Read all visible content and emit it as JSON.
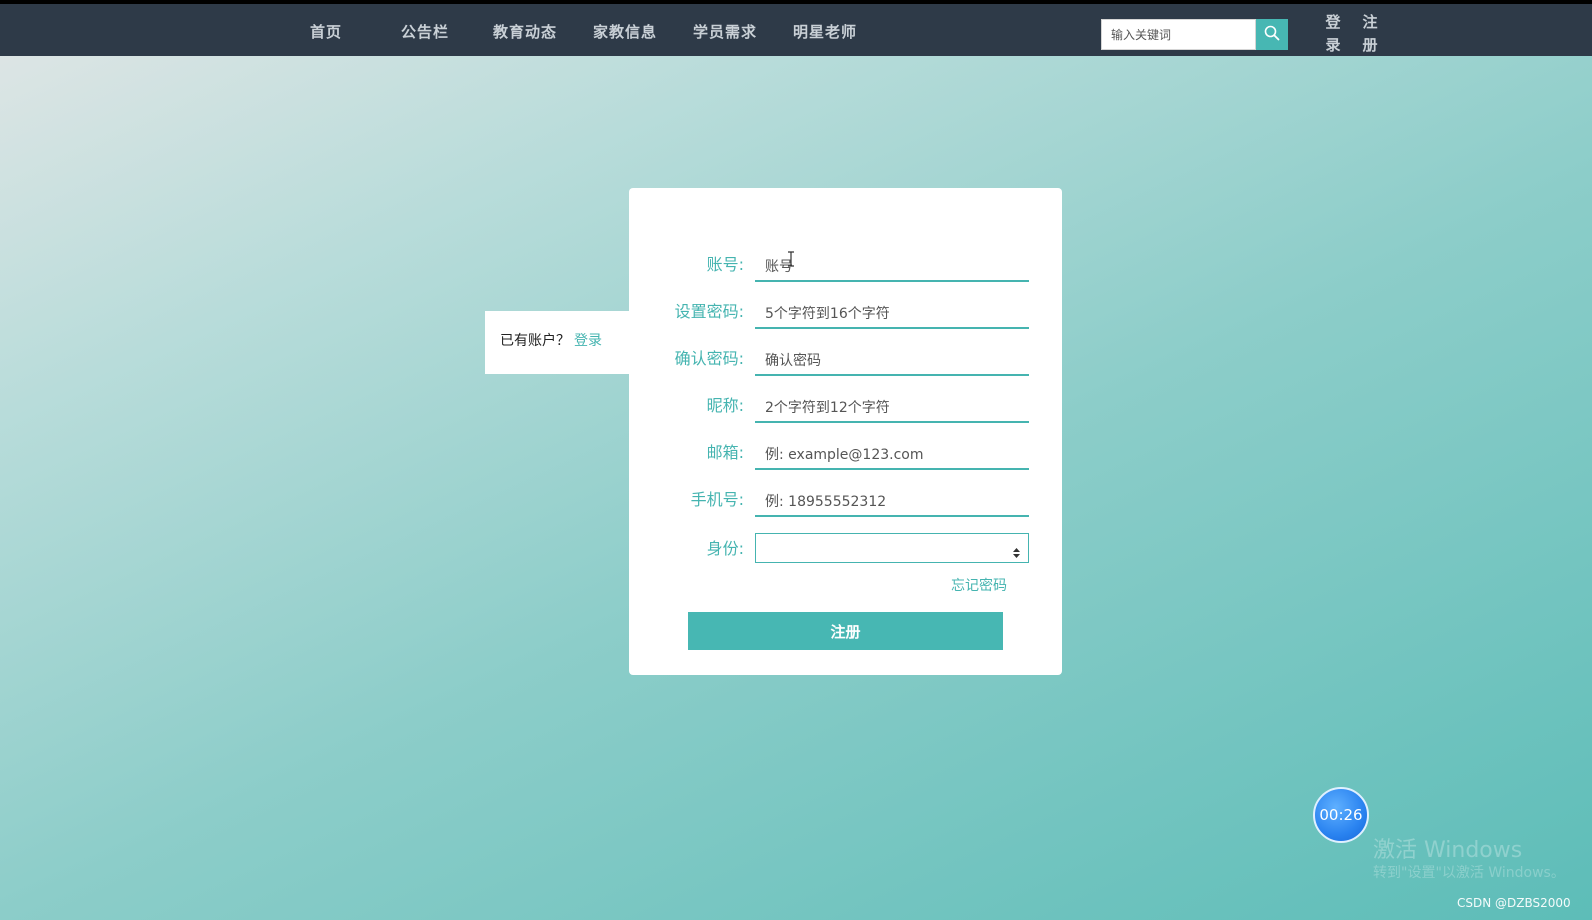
{
  "nav": {
    "items": [
      "首页",
      "公告栏",
      "教育动态",
      "家教信息",
      "学员需求",
      "明星老师"
    ],
    "search_placeholder": "输入关键词",
    "login_top": "登",
    "login_bottom": "录",
    "register_top": "注",
    "register_bottom": "册"
  },
  "login_hint": {
    "text": "已有账户？",
    "link": "登录"
  },
  "form": {
    "fields": [
      {
        "label": "账号:",
        "placeholder": "账号"
      },
      {
        "label": "设置密码:",
        "placeholder": "5个字符到16个字符"
      },
      {
        "label": "确认密码:",
        "placeholder": "确认密码"
      },
      {
        "label": "昵称:",
        "placeholder": "2个字符到12个字符"
      },
      {
        "label": "邮箱:",
        "placeholder": "例: example@123.com"
      },
      {
        "label": "手机号:",
        "placeholder": "例: 18955552312"
      }
    ],
    "identity_label": "身份:",
    "identity_value": "",
    "forgot": "忘记密码",
    "submit": "注册"
  },
  "timer": "00:26",
  "watermark": {
    "line1": "激活 Windows",
    "line2": "转到\"设置\"以激活 Windows。"
  },
  "credit": "CSDN @DZBS2000",
  "colors": {
    "accent": "#47b7b3",
    "navbar": "#2e3a48"
  }
}
